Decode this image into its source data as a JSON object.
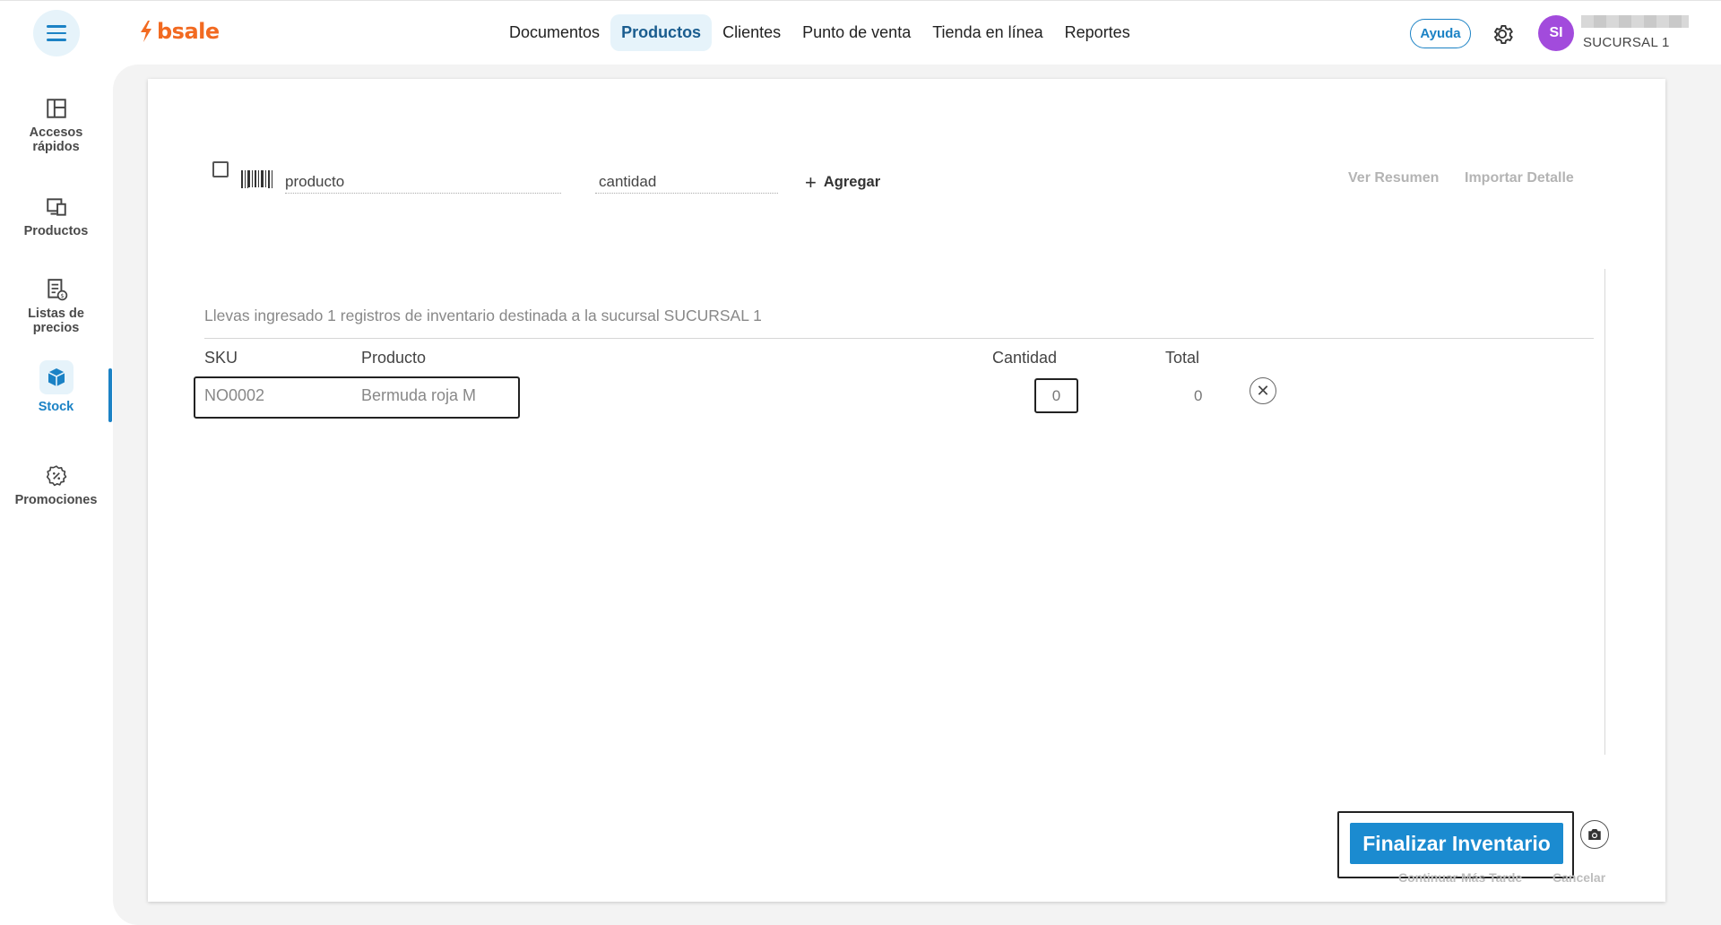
{
  "brand": {
    "name": "bsale",
    "accent": "#f26a21",
    "primary": "#1b82c5"
  },
  "nav": {
    "items": [
      {
        "label": "Documentos",
        "active": false
      },
      {
        "label": "Productos",
        "active": true
      },
      {
        "label": "Clientes",
        "active": false
      },
      {
        "label": "Punto de venta",
        "active": false
      },
      {
        "label": "Tienda en línea",
        "active": false
      },
      {
        "label": "Reportes",
        "active": false
      }
    ],
    "help_label": "Ayuda",
    "settings_icon": "gear-icon"
  },
  "user": {
    "initials": "SI",
    "branch": "SUCURSAL 1"
  },
  "sidebar": {
    "items": [
      {
        "label_line1": "Accesos",
        "label_line2": "rápidos",
        "icon": "dashboard-icon"
      },
      {
        "label_line1": "Productos",
        "label_line2": "",
        "icon": "products-icon"
      },
      {
        "label_line1": "Listas de",
        "label_line2": "precios",
        "icon": "price-list-icon"
      },
      {
        "label_line1": "Stock",
        "label_line2": "",
        "icon": "box-icon",
        "active": true
      },
      {
        "label_line1": "Promociones",
        "label_line2": "",
        "icon": "discount-icon"
      }
    ]
  },
  "entry": {
    "product_placeholder": "producto",
    "quantity_placeholder": "cantidad",
    "add_label": "Agregar",
    "view_summary": "Ver Resumen",
    "import_detail": "Importar Detalle"
  },
  "inventory": {
    "summary": "Llevas ingresado 1 registros de inventario destinada a la sucursal SUCURSAL 1",
    "columns": {
      "sku": "SKU",
      "product": "Producto",
      "quantity": "Cantidad",
      "total": "Total"
    },
    "rows": [
      {
        "sku": "NO0002",
        "product": "Bermuda roja M",
        "quantity": "0",
        "total": "0"
      }
    ]
  },
  "actions": {
    "finalize": "Finalizar Inventario",
    "continue_later": "Continuar Más Tarde",
    "cancel": "Cancelar"
  }
}
